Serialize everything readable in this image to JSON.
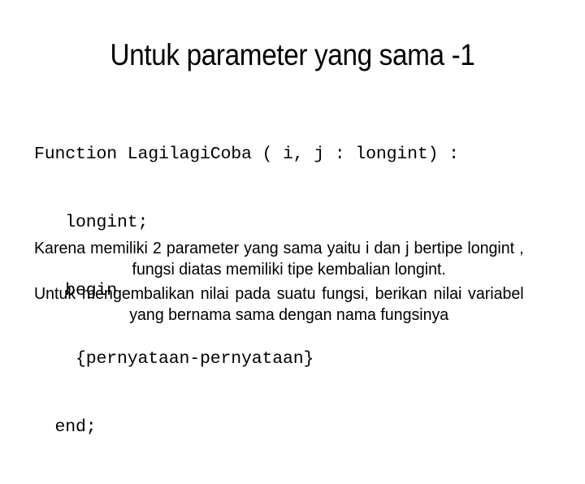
{
  "slide": {
    "title": "Untuk parameter yang sama -1",
    "background_color": "#ffffff",
    "text_color": "#000000",
    "code": {
      "lines": [
        "Function LagilagiCoba ( i, j : longint) :",
        "   longint;",
        "   begin",
        "    {pernyataan-pernyataan}",
        "  end;"
      ]
    },
    "paragraphs": [
      "Karena memiliki 2 parameter yang sama yaitu i dan j bertipe longint , fungsi diatas memiliki tipe kembalian longint.",
      "Untuk mengembalikan nilai pada suatu fungsi, berikan nilai variabel yang bernama sama dengan nama fungsinya"
    ]
  }
}
